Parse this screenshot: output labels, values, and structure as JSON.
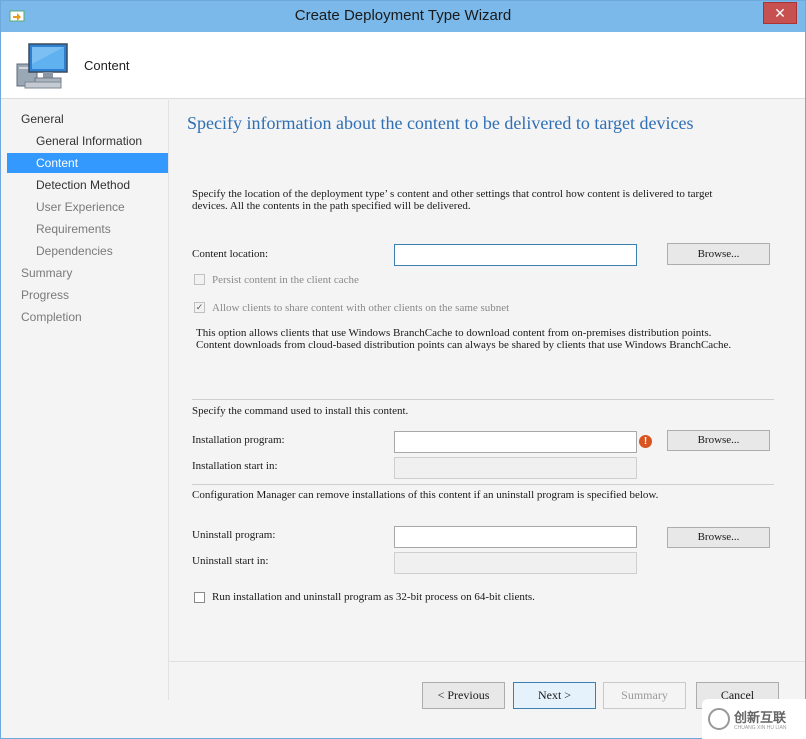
{
  "window": {
    "title": "Create Deployment Type Wizard",
    "close_glyph": "✕"
  },
  "header": {
    "title": "Content"
  },
  "sidebar": {
    "items": [
      {
        "label": "General"
      },
      {
        "label": "General Information"
      },
      {
        "label": "Content"
      },
      {
        "label": "Detection Method"
      },
      {
        "label": "User Experience"
      },
      {
        "label": "Requirements"
      },
      {
        "label": "Dependencies"
      },
      {
        "label": "Summary"
      },
      {
        "label": "Progress"
      },
      {
        "label": "Completion"
      }
    ]
  },
  "main": {
    "heading": "Specify information about the content to be delivered to target devices",
    "intro_line1": "Specify the location of the deployment type’ s content and other settings that control how content is delivered to target",
    "intro_line2": "devices. All the contents in the path specified will be delivered.",
    "content_location_label": "Content location:",
    "content_location_value": "",
    "browse_label": "Browse...",
    "persist_label": "Persist content in the client cache",
    "allow_share_label": "Allow clients to share content with other clients on the same subnet",
    "branchcache_line1": "This option allows clients that use Windows BranchCache to download content from on-premises distribution points.",
    "branchcache_line2": "Content downloads from cloud-based distribution points can always be shared by clients that use Windows BranchCache.",
    "install_section_label": "Specify the command used to install this content.",
    "install_program_label": "Installation program:",
    "install_program_value": "",
    "install_start_label": "Installation start in:",
    "install_start_value": "",
    "uninstall_note": "Configuration Manager can remove installations of this content if an uninstall program is specified below.",
    "uninstall_program_label": "Uninstall program:",
    "uninstall_program_value": "",
    "uninstall_start_label": "Uninstall start in:",
    "uninstall_start_value": "",
    "run32_label": "Run installation and uninstall program as 32-bit process on 64-bit clients.",
    "error_glyph": "!"
  },
  "footer": {
    "previous_label": "< Previous",
    "next_label": "Next >",
    "summary_label": "Summary",
    "cancel_label": "Cancel"
  },
  "watermark": {
    "text": "创新互联",
    "sub": "CHUANG XIN HU LIAN"
  },
  "colors": {
    "titlebar": "#7ab9ea",
    "nav_active": "#3399ff",
    "heading": "#2e6fb5",
    "close": "#c75050"
  }
}
